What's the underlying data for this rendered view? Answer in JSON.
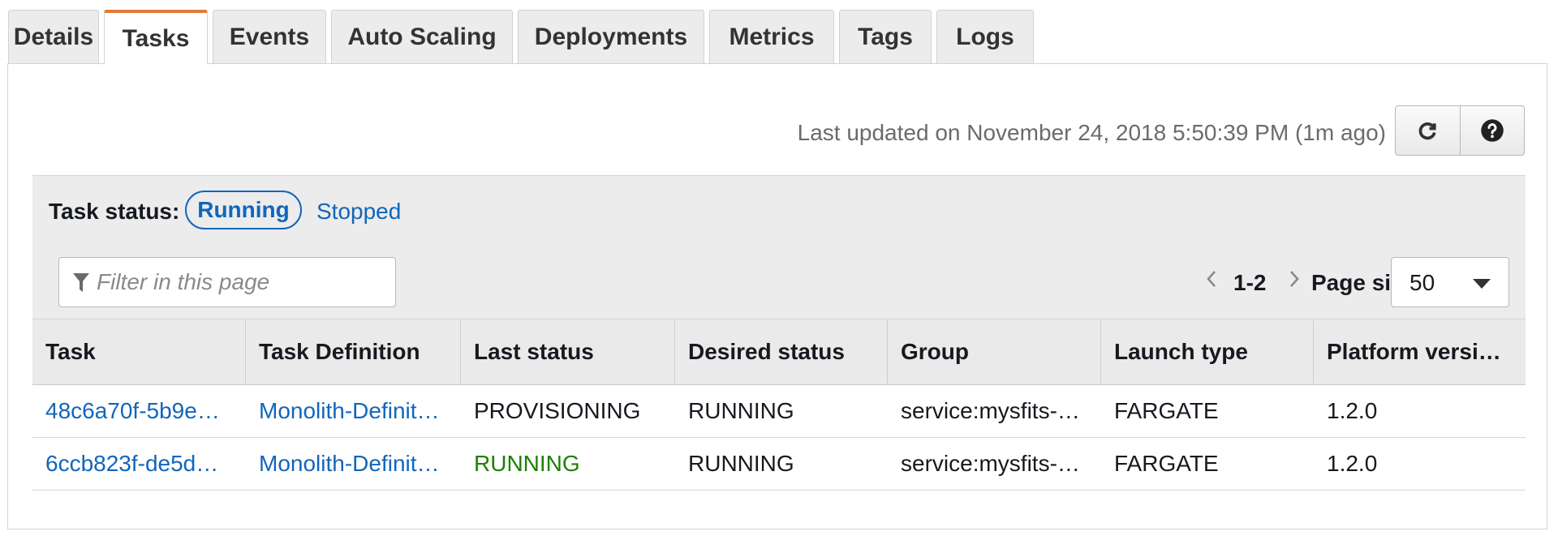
{
  "tabs": [
    {
      "label": "Details",
      "active": false
    },
    {
      "label": "Tasks",
      "active": true
    },
    {
      "label": "Events",
      "active": false
    },
    {
      "label": "Auto Scaling",
      "active": false
    },
    {
      "label": "Deployments",
      "active": false
    },
    {
      "label": "Metrics",
      "active": false
    },
    {
      "label": "Tags",
      "active": false
    },
    {
      "label": "Logs",
      "active": false
    }
  ],
  "last_updated": "Last updated on November 24, 2018 5:50:39 PM (1m ago)",
  "icons": {
    "refresh": "refresh-icon",
    "help": "help-icon",
    "filter": "filter-icon"
  },
  "task_status": {
    "label": "Task status:",
    "running": "Running",
    "stopped": "Stopped"
  },
  "filter": {
    "placeholder": "Filter in this page",
    "value": ""
  },
  "pager": {
    "range": "1-2",
    "page_size_label": "Page size",
    "page_size": "50"
  },
  "table": {
    "headers": [
      "Task",
      "Task Definition",
      "Last status",
      "Desired status",
      "Group",
      "Launch type",
      "Platform versi…"
    ],
    "rows": [
      [
        "48c6a70f-5b9e…",
        "Monolith-Definit…",
        "PROVISIONING",
        "RUNNING",
        "service:mysfits-…",
        "FARGATE",
        "1.2.0"
      ],
      [
        "6ccb823f-de5d…",
        "Monolith-Definit…",
        "RUNNING",
        "RUNNING",
        "service:mysfits-…",
        "FARGATE",
        "1.2.0"
      ]
    ]
  },
  "colors": {
    "accent_tab": "#e07b39",
    "link": "#1166bb",
    "running": "#1d8102"
  }
}
